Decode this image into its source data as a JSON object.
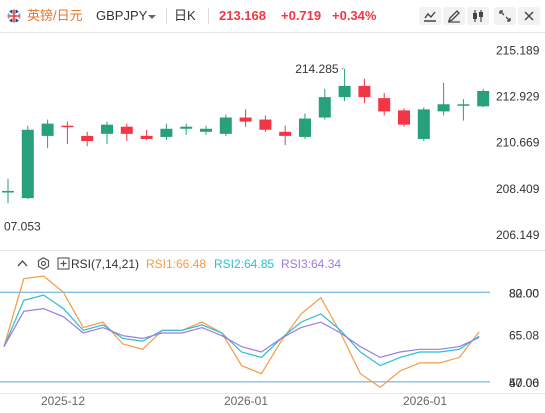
{
  "header": {
    "symbol_label": "英镑/日元",
    "symbol_code": "GBPJPY",
    "period": "日K",
    "price": "213.168",
    "change": "+0.719",
    "change_pct": "+0.34%"
  },
  "colors": {
    "up": "#26a17b",
    "down": "#f23645",
    "rise_text": "#f23645",
    "rsi1": "#f39c46",
    "rsi2": "#2bbfcf",
    "rsi3": "#9b7be0",
    "level": "#5aa6d6"
  },
  "rsi_header": {
    "title": "RSI(7,14,21)",
    "rsi1": "RSI1:66.48",
    "rsi2": "RSI2:64.85",
    "rsi3": "RSI3:64.34"
  },
  "chart_data": [
    {
      "type": "candlestick",
      "y_ticks": [
        "215.189",
        "212.929",
        "210.669",
        "208.409",
        "206.149"
      ],
      "ylim": [
        205.9,
        215.6
      ],
      "x_ticks": [
        "2025-12",
        "2026-01",
        "2026-01"
      ],
      "high_label": "214.285",
      "low_label": "07.053",
      "candles": [
        {
          "o": 208.3,
          "h": 208.9,
          "l": 207.7,
          "c": 208.3
        },
        {
          "o": 207.95,
          "h": 211.5,
          "l": 207.9,
          "c": 211.3
        },
        {
          "o": 211.0,
          "h": 211.8,
          "l": 210.4,
          "c": 211.6
        },
        {
          "o": 211.5,
          "h": 211.7,
          "l": 210.6,
          "c": 211.45
        },
        {
          "o": 211.0,
          "h": 211.2,
          "l": 210.5,
          "c": 210.75
        },
        {
          "o": 211.1,
          "h": 211.7,
          "l": 210.6,
          "c": 211.55
        },
        {
          "o": 211.45,
          "h": 211.6,
          "l": 210.75,
          "c": 211.1
        },
        {
          "o": 211.0,
          "h": 211.3,
          "l": 210.8,
          "c": 210.85
        },
        {
          "o": 210.95,
          "h": 211.6,
          "l": 210.8,
          "c": 211.35
        },
        {
          "o": 211.35,
          "h": 211.6,
          "l": 211.05,
          "c": 211.45
        },
        {
          "o": 211.2,
          "h": 211.5,
          "l": 211.05,
          "c": 211.35
        },
        {
          "o": 211.1,
          "h": 212.05,
          "l": 211.0,
          "c": 211.9
        },
        {
          "o": 211.9,
          "h": 212.3,
          "l": 211.45,
          "c": 211.7
        },
        {
          "o": 211.8,
          "h": 212.0,
          "l": 211.2,
          "c": 211.3
        },
        {
          "o": 211.2,
          "h": 211.5,
          "l": 210.55,
          "c": 211.0
        },
        {
          "o": 210.95,
          "h": 212.1,
          "l": 210.85,
          "c": 211.85
        },
        {
          "o": 211.9,
          "h": 213.3,
          "l": 211.8,
          "c": 212.9
        },
        {
          "o": 212.9,
          "h": 214.285,
          "l": 212.7,
          "c": 213.45
        },
        {
          "o": 213.45,
          "h": 213.8,
          "l": 212.6,
          "c": 212.9
        },
        {
          "o": 212.85,
          "h": 213.1,
          "l": 212.0,
          "c": 212.2
        },
        {
          "o": 212.25,
          "h": 212.35,
          "l": 211.45,
          "c": 211.55
        },
        {
          "o": 210.85,
          "h": 212.4,
          "l": 210.75,
          "c": 212.3
        },
        {
          "o": 212.2,
          "h": 213.6,
          "l": 212.0,
          "c": 212.55
        },
        {
          "o": 212.5,
          "h": 212.8,
          "l": 211.75,
          "c": 212.55
        },
        {
          "o": 212.45,
          "h": 213.3,
          "l": 212.4,
          "c": 213.2
        }
      ]
    },
    {
      "type": "line",
      "name": "RSI",
      "y_ticks": [
        "82.00",
        "80.00",
        "65.08",
        "50.00",
        "47.06"
      ],
      "levels": [
        81.0,
        48.0
      ],
      "ylim": [
        45,
        87
      ],
      "series": [
        {
          "name": "RSI1",
          "values": [
            61,
            86,
            87,
            81,
            68,
            70,
            62,
            60,
            67,
            67,
            70,
            66,
            54,
            51,
            63,
            73,
            79,
            66,
            51,
            46,
            52,
            55,
            55,
            57,
            66.48
          ]
        },
        {
          "name": "RSI2",
          "values": [
            61,
            78,
            80,
            75,
            67,
            69,
            64,
            63,
            67,
            67,
            69,
            66,
            59,
            57,
            64,
            70,
            73,
            67,
            59,
            54,
            57,
            59,
            59,
            60,
            64.85
          ]
        },
        {
          "name": "RSI3",
          "values": [
            61,
            74,
            75,
            72,
            66,
            68,
            65,
            64,
            66,
            66,
            68,
            65,
            61,
            59,
            64,
            68,
            70,
            66,
            61,
            57,
            59,
            60,
            60,
            61,
            64.34
          ]
        }
      ]
    }
  ]
}
